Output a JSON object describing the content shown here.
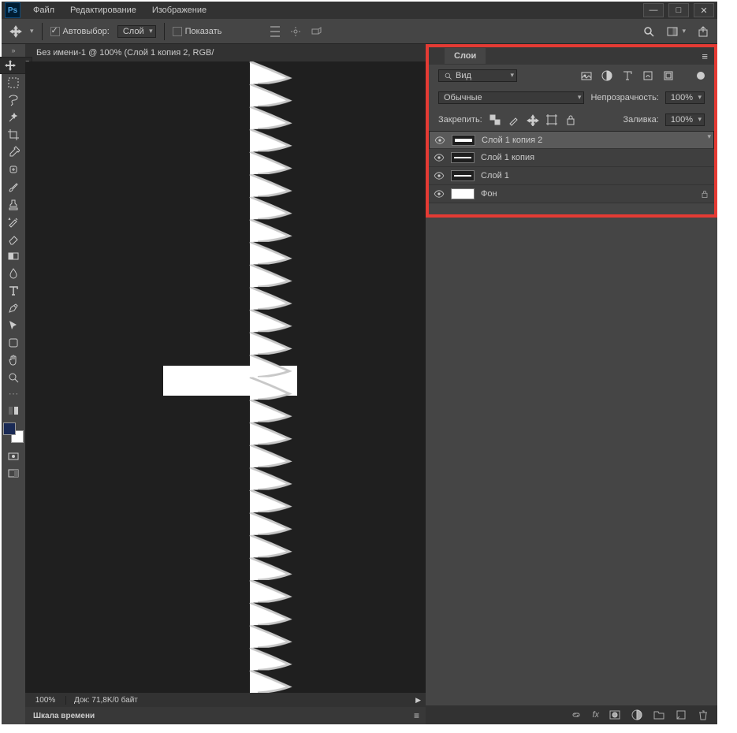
{
  "menu": {
    "items": [
      "Файл",
      "Редактирование",
      "Изображение"
    ],
    "ps": "Ps"
  },
  "optbar": {
    "autoselect": "Автовыбор:",
    "layer_sel": "Слой",
    "show": "Показать"
  },
  "doc": {
    "tab": "Без имени-1 @ 100% (Слой 1 копия 2, RGB/"
  },
  "status": {
    "zoom": "100%",
    "doc": "Док: 71,8K/0 байт"
  },
  "timeline": {
    "tab": "Шкала времени"
  },
  "layers": {
    "tab": "Слои",
    "kind_search": "Вид",
    "blend": "Обычные",
    "opacity_label": "Непрозрачность:",
    "opacity_value": "100%",
    "lock_label": "Закрепить:",
    "fill_label": "Заливка:",
    "fill_value": "100%",
    "items": [
      {
        "name": "Слой 1 копия 2",
        "selected": true,
        "dbl": true
      },
      {
        "name": "Слой 1 копия",
        "selected": false,
        "dbl": false
      },
      {
        "name": "Слой 1",
        "selected": false,
        "dbl": false
      },
      {
        "name": "Фон",
        "selected": false,
        "dbl": false,
        "locked": true
      }
    ]
  }
}
